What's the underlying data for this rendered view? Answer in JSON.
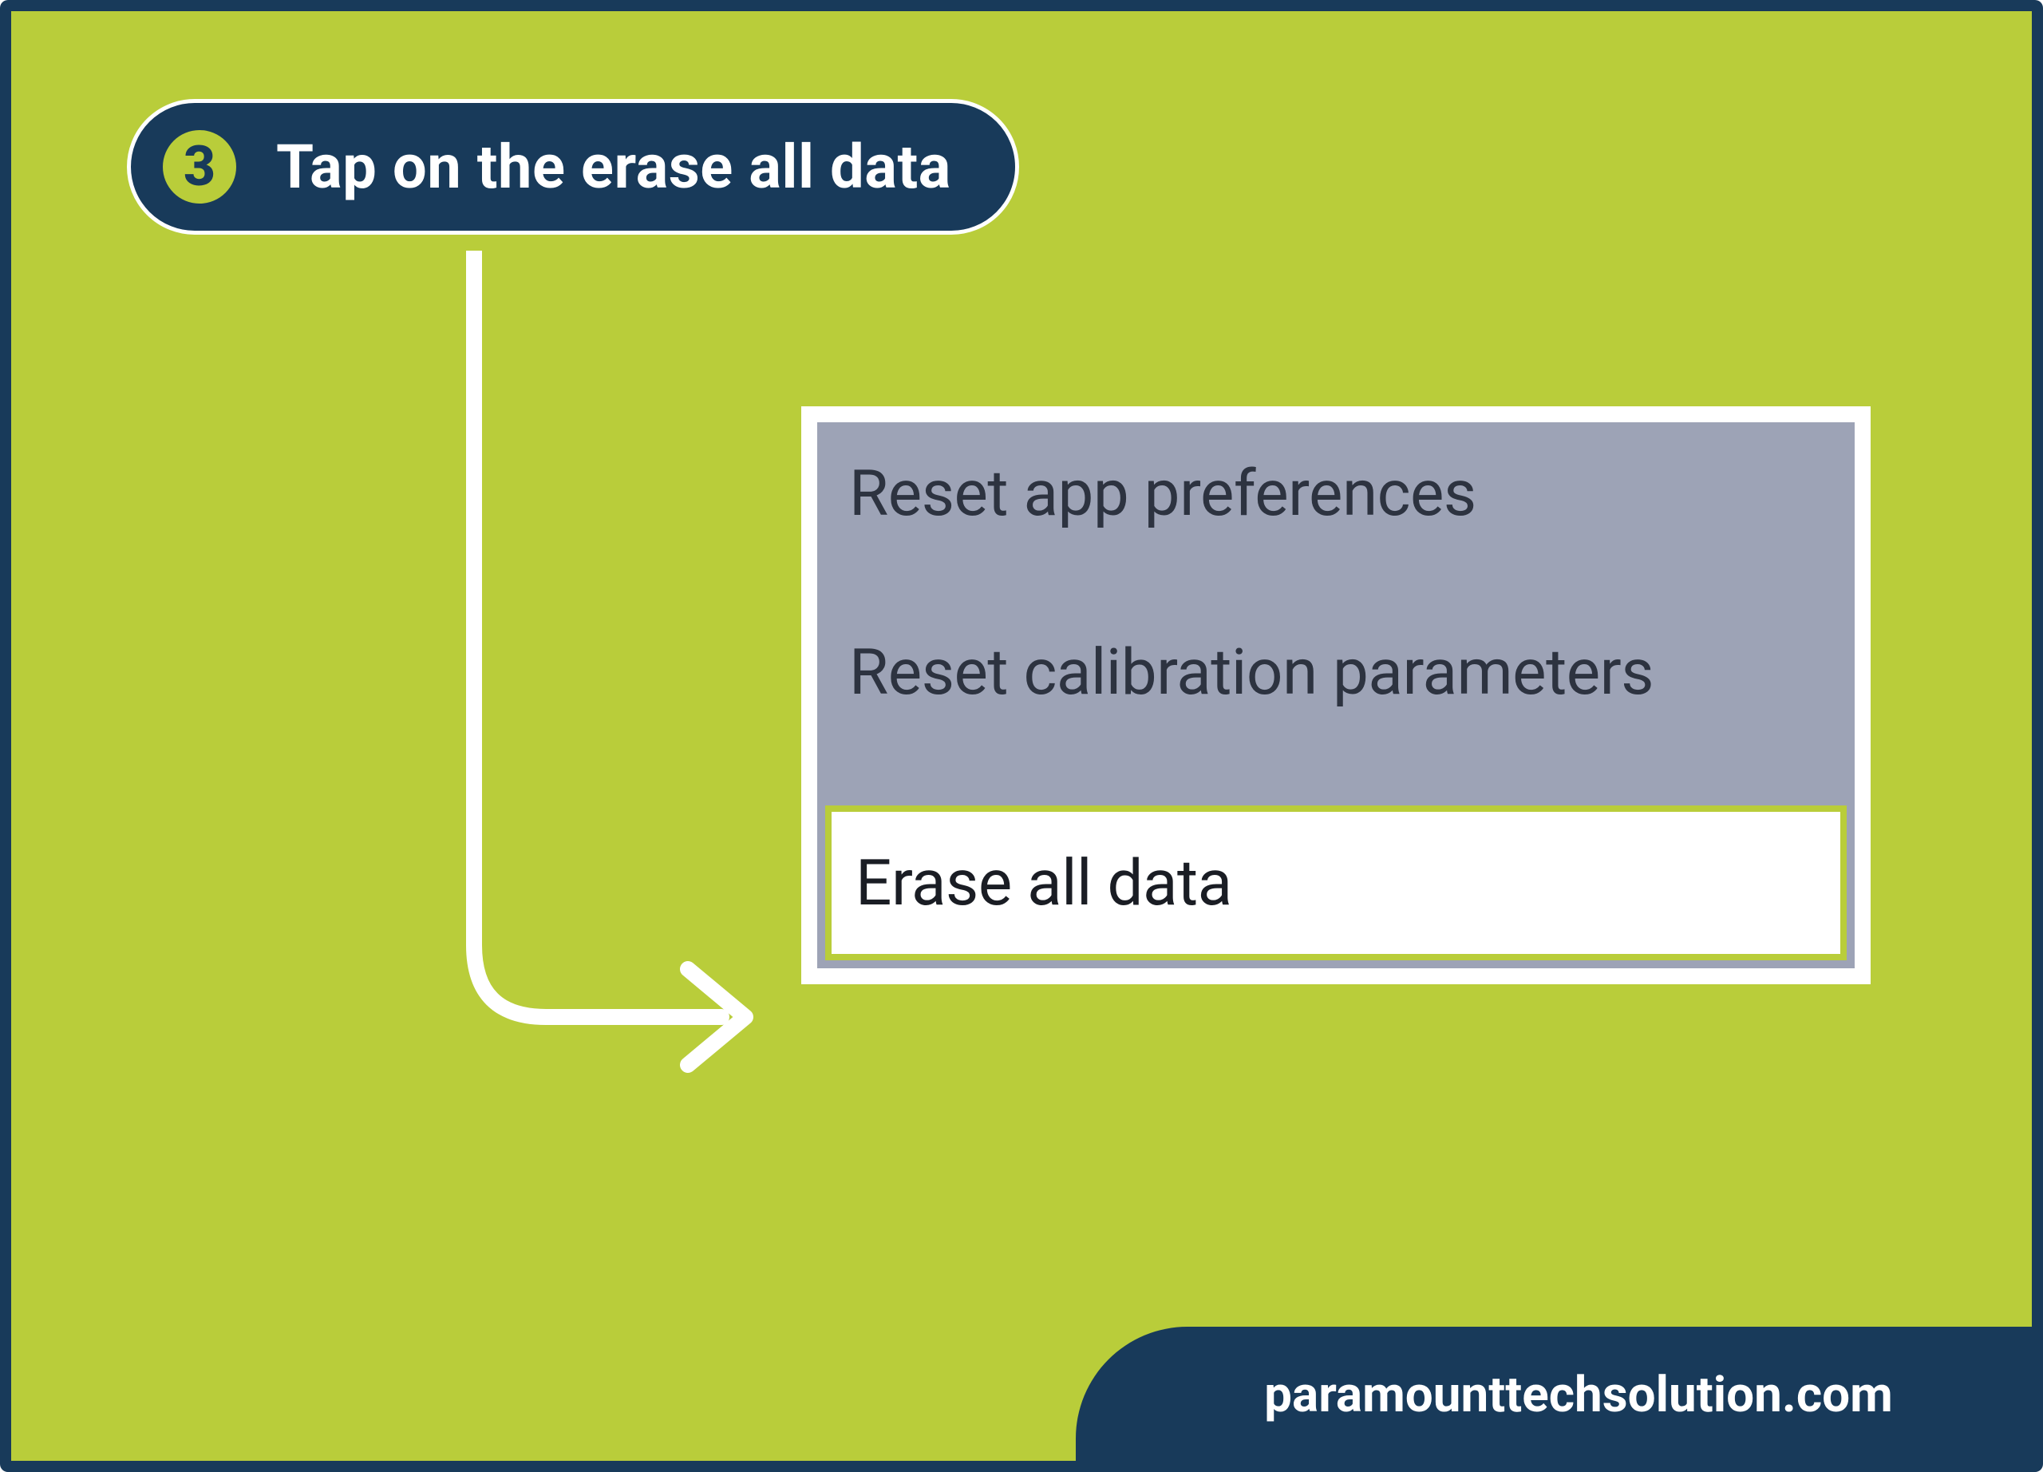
{
  "step": {
    "number": "3",
    "label": "Tap on the erase all data"
  },
  "menu": {
    "items": [
      {
        "label": "Reset app preferences",
        "highlighted": false
      },
      {
        "label": "Reset calibration parameters",
        "highlighted": false
      },
      {
        "label": "Erase all data",
        "highlighted": true
      }
    ]
  },
  "brand": "paramounttechsolution.com",
  "colors": {
    "accent": "#b9cd3a",
    "dark": "#183a5a",
    "panel_grey": "#9da3b6"
  }
}
